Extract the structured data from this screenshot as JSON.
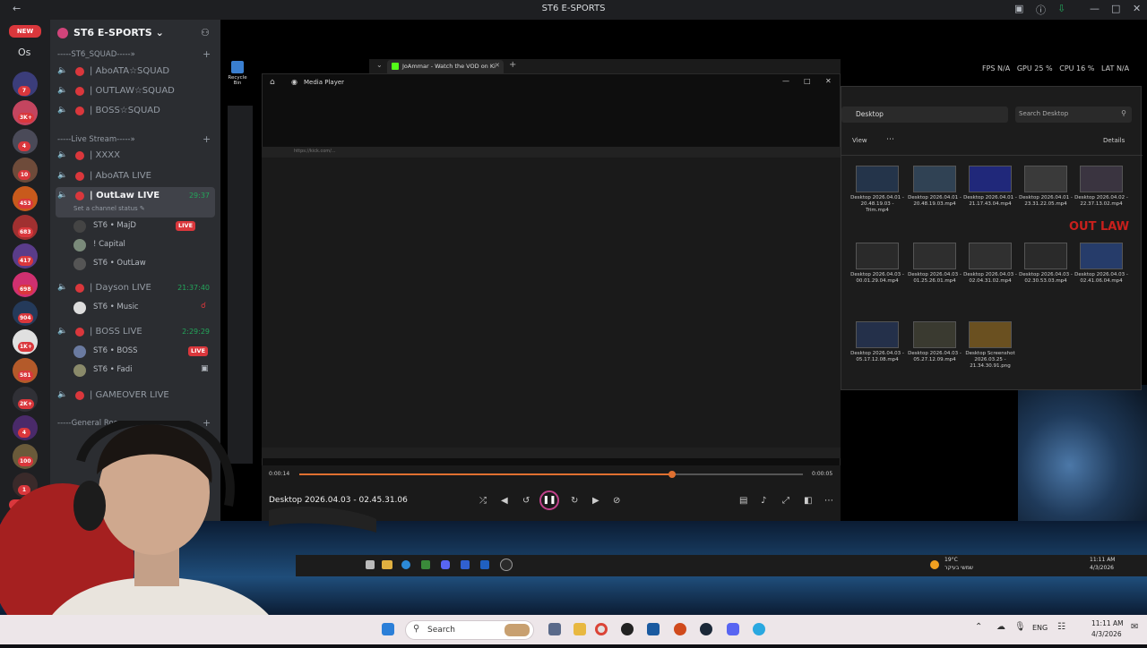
{
  "top": {
    "title": "ST6 E-SPORTS"
  },
  "rail": {
    "os_label": "Os",
    "new_label": "NEW",
    "badges": [
      "7",
      "3K+",
      "4",
      "10",
      "453",
      "683",
      "417",
      "698",
      "904",
      "1K+",
      "581",
      "2K+",
      "4",
      "100",
      "1",
      "NEW"
    ]
  },
  "sidebar": {
    "server_name": "ST6 E-SPORTS",
    "categories": [
      {
        "label": "-----ST6_SQUAD-----»"
      },
      {
        "label": "-----Live Stream-----»"
      },
      {
        "label": "-----General Rooms-----»"
      }
    ],
    "channels": [
      {
        "name": "| AboATA☆SQUAD"
      },
      {
        "name": "| OUTLAW☆SQUAD"
      },
      {
        "name": "| BOSS☆SQUAD"
      },
      {
        "name": "| XXXX"
      },
      {
        "name": "| AboATA LIVE"
      },
      {
        "name": "| OutLaw LIVE",
        "time": "29:37",
        "status": "Set a channel status"
      },
      {
        "name": "| Dayson LIVE",
        "time": "21:37:40"
      },
      {
        "name": "| BOSS LIVE",
        "time": "2:29:29"
      },
      {
        "name": "| GAMEOVER LIVE"
      }
    ],
    "users": [
      {
        "name": "ST6 • MajD",
        "badge": "LIVE"
      },
      {
        "name": "! Capital"
      },
      {
        "name": "ST6 • OutLaw"
      },
      {
        "name": "ST6 • Music"
      },
      {
        "name": "ST6 • BOSS",
        "badge": "LIVE"
      },
      {
        "name": "ST6 • Fadi"
      }
    ]
  },
  "browser": {
    "tab_label": "JoAmmar - Watch the VOD on Ki"
  },
  "player": {
    "title": "Media Player",
    "time_current": "0:00:14",
    "time_total": "0:00:05",
    "progress": 0.74,
    "filename": "Desktop 2026.04.03 - 02.45.31.06"
  },
  "stream_overlay": {
    "fps": "FPS N/A",
    "gpu": "GPU 25 %",
    "cpu": "CPU 16 %",
    "lat": "LAT N/A",
    "url": "https://kick.com/..."
  },
  "explorer": {
    "path": "Desktop",
    "search_placeholder": "Search Desktop",
    "view_label": "View",
    "details_label": "Details",
    "files": [
      {
        "name": "Desktop 2026.04.01 - 20.48.19.03 - Trim.mp4"
      },
      {
        "name": "Desktop 2026.04.01 - 20.48.19.03.mp4"
      },
      {
        "name": "Desktop 2026.04.01 - 21.17.43.04.mp4"
      },
      {
        "name": "Desktop 2026.04.01 - 23.31.22.05.mp4"
      },
      {
        "name": "Desktop 2026.04.02 - 22.37.13.02.mp4"
      },
      {
        "name": "Desktop 2026.04.03 - 00.01.29.04.mp4"
      },
      {
        "name": "Desktop 2026.04.03 - 01.25.26.01.mp4"
      },
      {
        "name": "Desktop 2026.04.03 - 02.04.31.02.mp4"
      },
      {
        "name": "Desktop 2026.04.03 - 02.30.53.03.mp4"
      },
      {
        "name": "Desktop 2026.04.03 - 02.41.06.04.mp4"
      },
      {
        "name": "Desktop 2026.04.03 - 05.17.12.08.mp4"
      },
      {
        "name": "Desktop 2026.04.03 - 05.27.12.09.mp4"
      },
      {
        "name": "Desktop Screenshot 2026.03.25 - 21.34.30.91.png"
      }
    ],
    "logo_text": "OUT LAW"
  },
  "desktop_icons": {
    "recycle_bin": "Recycle Bin"
  },
  "inner_taskbar": {
    "weather": "19°C",
    "weather_text": "שמשי בעיקר",
    "time": "11:11 AM",
    "date": "4/3/2026"
  },
  "taskbar": {
    "search_label": "Search",
    "lang": "ENG",
    "time": "11:11 AM",
    "date": "4/3/2026"
  }
}
